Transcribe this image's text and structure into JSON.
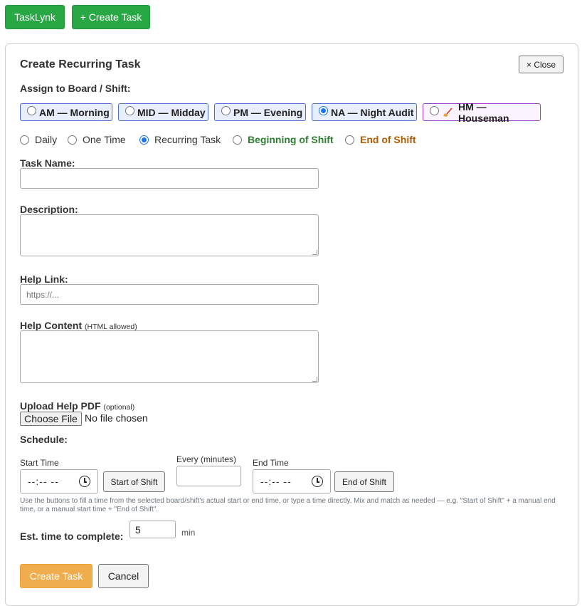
{
  "header": {
    "brand_label": "TaskLynk",
    "create_label": "+ Create Task"
  },
  "form": {
    "title": "Create Recurring Task",
    "close_label": "× Close",
    "assign_label": "Assign to Board / Shift:",
    "boards": [
      {
        "label": "AM — Morning",
        "selected": false
      },
      {
        "label": "MID — Midday",
        "selected": false
      },
      {
        "label": "PM — Evening",
        "selected": false
      },
      {
        "label": "NA — Night Audit",
        "selected": true
      },
      {
        "label": "HM — Houseman",
        "selected": false,
        "icon": "broom-icon"
      }
    ],
    "frequency": [
      {
        "label": "Daily",
        "selected": false
      },
      {
        "label": "One Time",
        "selected": false
      },
      {
        "label": "Recurring Task",
        "selected": true
      },
      {
        "label": "Beginning of Shift",
        "selected": false,
        "color": "#2e7d32"
      },
      {
        "label": "End of Shift",
        "selected": false,
        "color": "#b35a00"
      }
    ],
    "task_name_label": "Task Name:",
    "task_name_value": "",
    "description_label": "Description:",
    "description_value": "",
    "help_link_label": "Help Link:",
    "help_link_placeholder": "https://...",
    "help_content_label": "Help Content",
    "help_content_note": "(HTML allowed)",
    "upload_label": "Upload Help PDF",
    "upload_note": "(optional)",
    "choose_file_label": "Choose File",
    "no_file_label": "No file chosen",
    "schedule_label": "Schedule:",
    "start_time_label": "Start Time",
    "start_time_value": "--:-- --",
    "start_of_shift_label": "Start of Shift",
    "every_label": "Every (minutes)",
    "every_value": "",
    "end_time_label": "End Time",
    "end_time_value": "--:-- --",
    "end_of_shift_label": "End of Shift",
    "help_text": "Use the buttons to fill a time from the selected board/shift's actual start or end time, or type a time directly. Mix and match as needed — e.g. \"Start of Shift\" + a manual end time, or a manual start time + \"End of Shift\".",
    "est_label": "Est. time to complete:",
    "est_value": "5",
    "est_unit": "min",
    "submit_label": "Create Task",
    "cancel_label": "Cancel"
  },
  "colors": {
    "primary_green": "#28a745",
    "submit_orange": "#f0ad4e",
    "chip_blue": "#4a6fd0",
    "chip_purple": "#9b3fc3"
  }
}
